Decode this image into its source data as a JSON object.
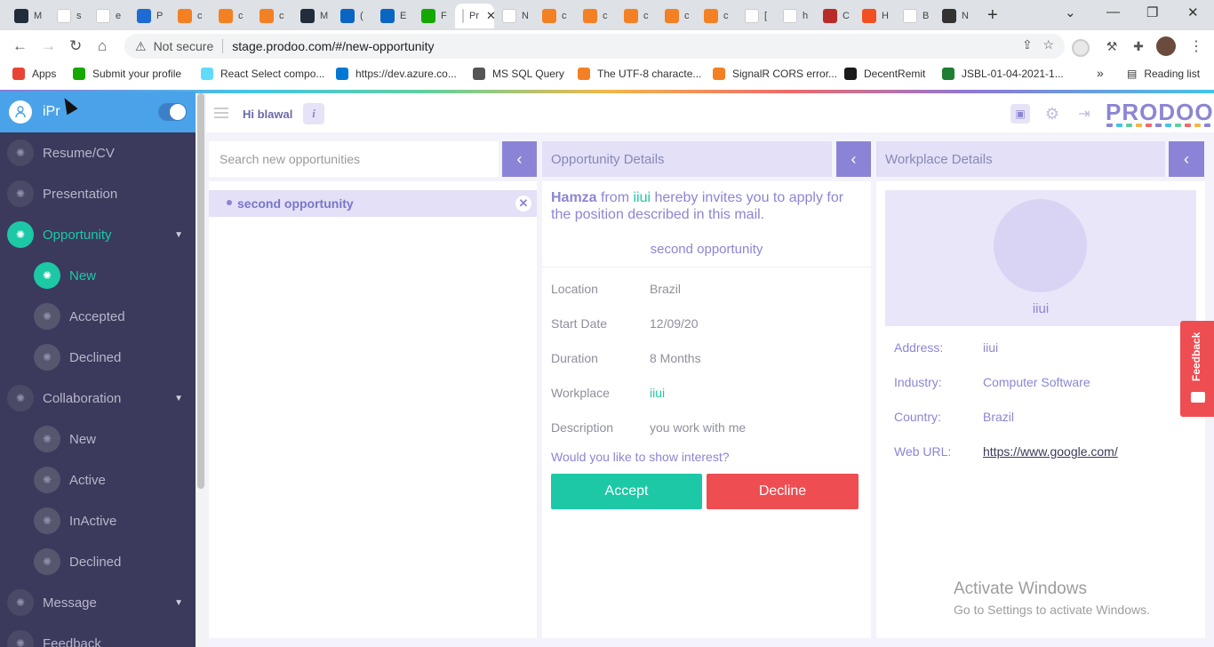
{
  "browser": {
    "tabs": [
      {
        "label": "M",
        "color": "#222c3a"
      },
      {
        "label": "s",
        "color": "#ffffff"
      },
      {
        "label": "e",
        "color": "#ffffff"
      },
      {
        "label": "P",
        "color": "#1f6bd4"
      },
      {
        "label": "c",
        "color": "#f48024"
      },
      {
        "label": "c",
        "color": "#f48024"
      },
      {
        "label": "c",
        "color": "#f48024"
      },
      {
        "label": "M",
        "color": "#222c3a"
      },
      {
        "label": "(",
        "color": "#0a66c2"
      },
      {
        "label": "E",
        "color": "#0a66c2"
      },
      {
        "label": "F",
        "color": "#14a800"
      },
      {
        "label": "Pr",
        "color": "#ffffff",
        "active": true
      },
      {
        "label": "N",
        "color": "#ffffff"
      },
      {
        "label": "c",
        "color": "#f48024"
      },
      {
        "label": "c",
        "color": "#f48024"
      },
      {
        "label": "c",
        "color": "#f48024"
      },
      {
        "label": "c",
        "color": "#f48024"
      },
      {
        "label": "c",
        "color": "#f48024"
      },
      {
        "label": "[",
        "color": "#ffffff"
      },
      {
        "label": "h",
        "color": "#ffffff"
      },
      {
        "label": "C",
        "color": "#b92b27"
      },
      {
        "label": "H",
        "color": "#f25022"
      },
      {
        "label": "B",
        "color": "#ffffff"
      },
      {
        "label": "N",
        "color": "#333333"
      }
    ],
    "not_secure": "Not secure",
    "url": "stage.prodoo.com/#/new-opportunity",
    "bookmarks": [
      {
        "label": "Apps",
        "color": "#ea4335"
      },
      {
        "label": "Submit your profile",
        "color": "#14a800"
      },
      {
        "label": "React Select compo...",
        "color": "#61dafb"
      },
      {
        "label": "https://dev.azure.co...",
        "color": "#0078d4"
      },
      {
        "label": "MS SQL Query",
        "color": "#555555"
      },
      {
        "label": "The UTF-8 characte...",
        "color": "#f48024"
      },
      {
        "label": "SignalR CORS error...",
        "color": "#f48024"
      },
      {
        "label": "DecentRemit",
        "color": "#1a1a1a"
      },
      {
        "label": "JSBL-01-04-2021-1...",
        "color": "#1e7e34"
      }
    ],
    "more_label": "»",
    "reading_list": "Reading list"
  },
  "sidebar": {
    "user_name": "iPr",
    "items": [
      {
        "label": "Resume/CV",
        "level": 1
      },
      {
        "label": "Presentation",
        "level": 1
      },
      {
        "label": "Opportunity",
        "level": 1,
        "active": true,
        "expandable": true
      },
      {
        "label": "New",
        "level": 2,
        "active": true
      },
      {
        "label": "Accepted",
        "level": 2
      },
      {
        "label": "Declined",
        "level": 2
      },
      {
        "label": "Collaboration",
        "level": 1,
        "expandable": true
      },
      {
        "label": "New",
        "level": 2
      },
      {
        "label": "Active",
        "level": 2
      },
      {
        "label": "InActive",
        "level": 2
      },
      {
        "label": "Declined",
        "level": 2
      },
      {
        "label": "Message",
        "level": 1,
        "expandable": true
      },
      {
        "label": "Feedback",
        "level": 1
      }
    ]
  },
  "topbar": {
    "greeting": "Hi blawal",
    "info": "i",
    "logo": "PRODOO"
  },
  "colors": {
    "accent": "#8b86d4",
    "green": "#1cc8a6",
    "sidebar_bg": "#3b3a5c",
    "decline": "#ee4d52"
  },
  "search": {
    "placeholder": "Search new opportunities"
  },
  "opportunities": [
    {
      "label": "second opportunity"
    }
  ],
  "details": {
    "header": "Opportunity Details",
    "sender": "Hamza",
    "from_word": "from",
    "company": "iiui",
    "invite_text": "hereby invites you to apply for the position described in this mail.",
    "title": "second opportunity",
    "rows": [
      {
        "label": "Location",
        "value": "Brazil"
      },
      {
        "label": "Start Date",
        "value": "12/09/20"
      },
      {
        "label": "Duration",
        "value": "8 Months"
      },
      {
        "label": "Workplace",
        "value": "iiui",
        "green": true
      },
      {
        "label": "Description",
        "value": "you work with me"
      }
    ],
    "question": "Would you like to show interest?",
    "accept_label": "Accept",
    "decline_label": "Decline"
  },
  "workplace": {
    "header": "Workplace Details",
    "name": "iiui",
    "rows": [
      {
        "label": "Address:",
        "value": "iiui"
      },
      {
        "label": "Industry:",
        "value": "Computer Software"
      },
      {
        "label": "Country:",
        "value": "Brazil"
      },
      {
        "label": "Web URL:",
        "value": "https://www.google.com/",
        "link": true
      }
    ]
  },
  "feedback_tab": "Feedback",
  "watermark": {
    "line1": "Activate Windows",
    "line2": "Go to Settings to activate Windows."
  }
}
